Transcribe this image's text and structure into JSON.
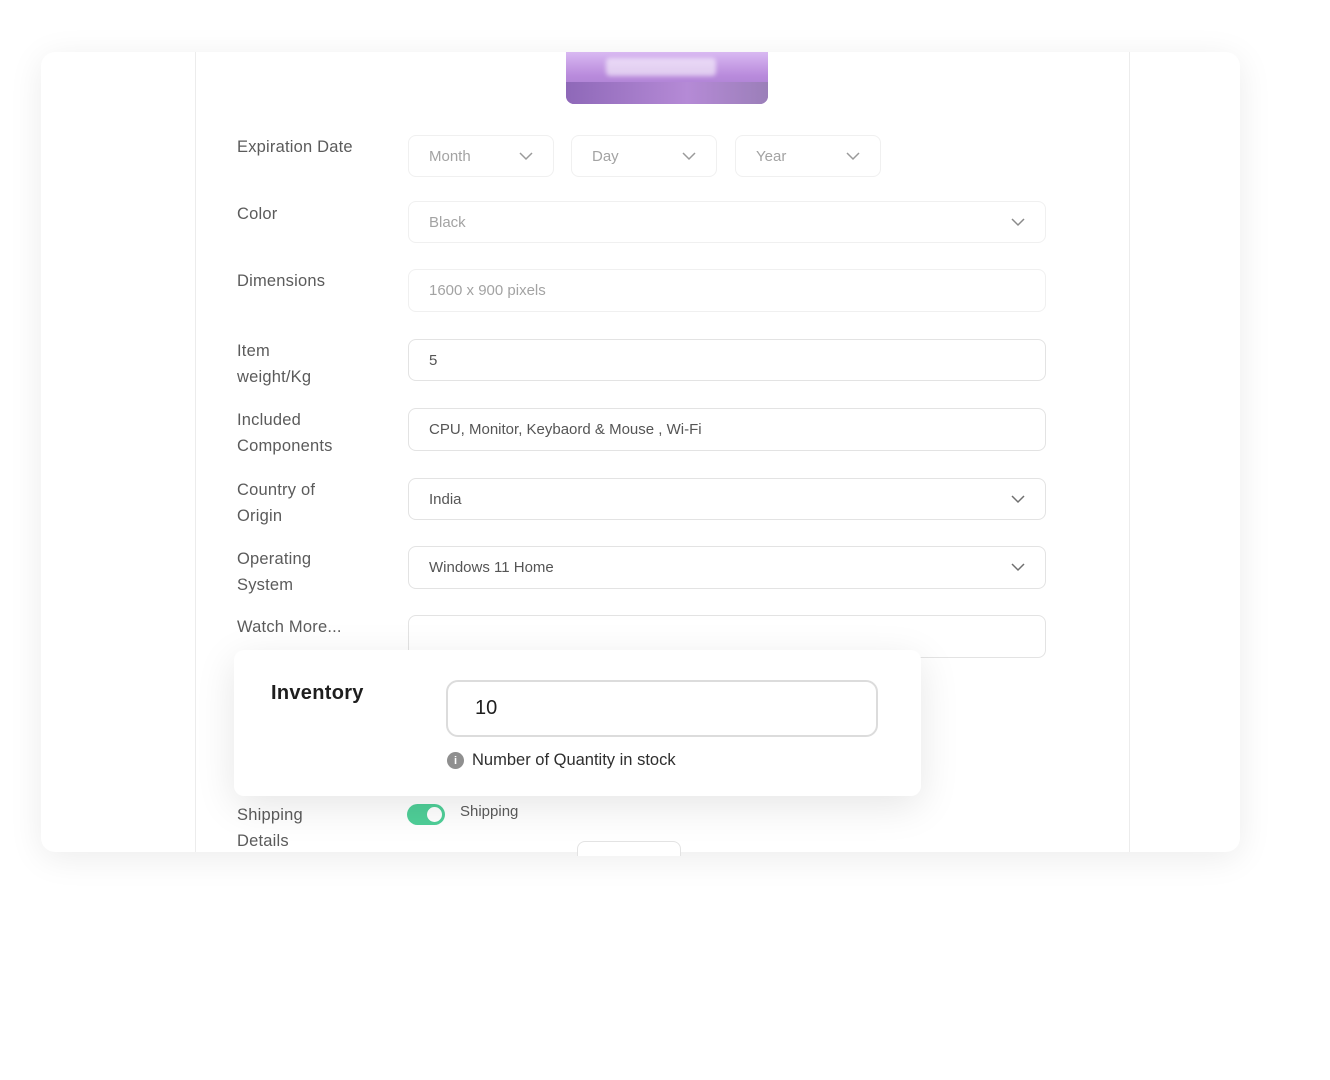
{
  "form": {
    "expiration": {
      "label": "Expiration Date",
      "month_placeholder": "Month",
      "day_placeholder": "Day",
      "year_placeholder": "Year"
    },
    "color": {
      "label": "Color",
      "value": "Black"
    },
    "dimensions": {
      "label": "Dimensions",
      "placeholder": "1600 x 900 pixels"
    },
    "item_weight": {
      "label": "Item weight/Kg",
      "value": "5"
    },
    "included_components": {
      "label": "Included Components",
      "value": "CPU, Monitor, Keybaord & Mouse , Wi-Fi"
    },
    "country_of_origin": {
      "label": "Country of Origin",
      "value": "India"
    },
    "operating_system": {
      "label": "Operating System",
      "value": "Windows 11 Home"
    },
    "watch_more": {
      "label": "Watch More...",
      "value": ""
    },
    "shipping_details": {
      "label": "Shipping Details",
      "toggle_label": "Shipping",
      "toggle_on": true
    }
  },
  "inventory": {
    "title": "Inventory",
    "value": "10",
    "helper": "Number of Quantity in stock"
  },
  "colors": {
    "toggle_on": "#4fcf98",
    "label_text": "#5b5b5b",
    "heading_text": "#1e1e1e"
  }
}
